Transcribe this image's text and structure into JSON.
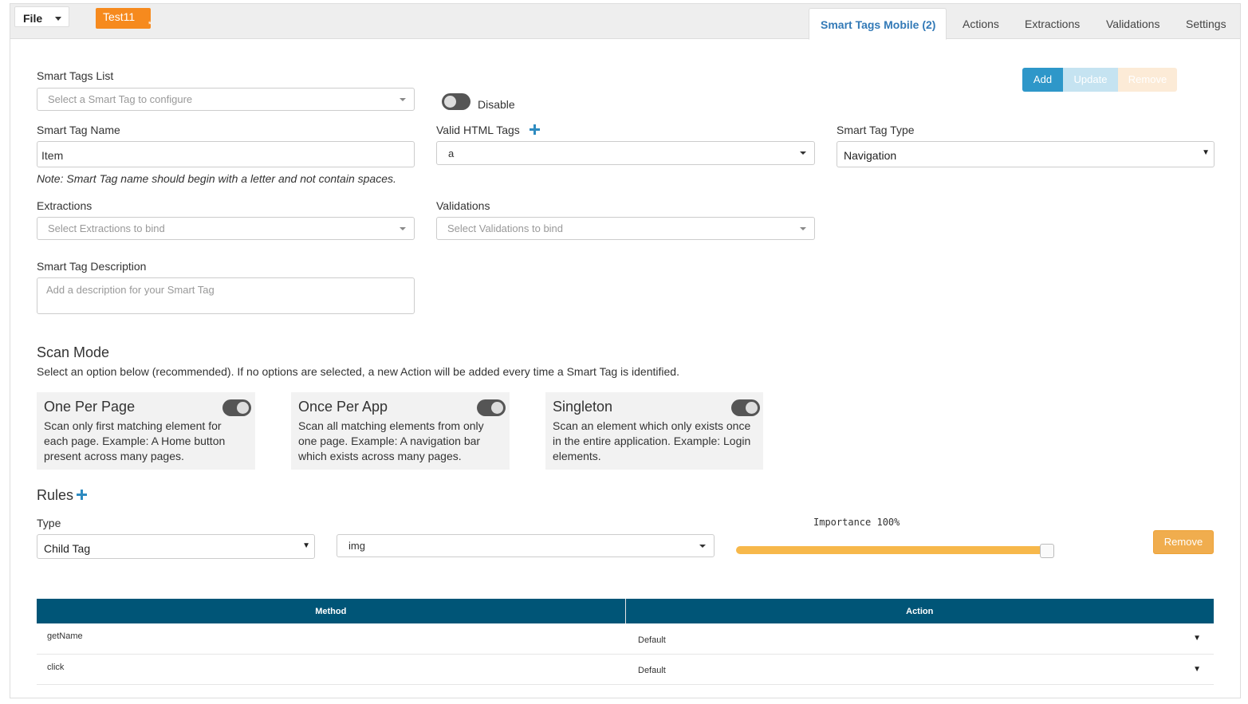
{
  "header": {
    "file_label": "File",
    "project_name": "Test11",
    "unsaved_marker": "*",
    "tabs": [
      "Smart Tags Mobile (2)",
      "Actions",
      "Extractions",
      "Validations",
      "Settings"
    ]
  },
  "form": {
    "smart_tags_list_label": "Smart Tags List",
    "smart_tags_list_placeholder": "Select a Smart Tag to configure",
    "disable_label": "Disable",
    "buttons": {
      "add": "Add",
      "update": "Update",
      "remove": "Remove"
    },
    "smart_tag_name_label": "Smart Tag Name",
    "smart_tag_name_value": "Item",
    "name_note": "Note: Smart Tag name should begin with a letter and not contain spaces.",
    "valid_html_tags_label": "Valid HTML Tags",
    "valid_html_tags_value": "a",
    "smart_tag_type_label": "Smart Tag Type",
    "smart_tag_type_value": "Navigation",
    "extractions_label": "Extractions",
    "extractions_placeholder": "Select Extractions to bind",
    "validations_label": "Validations",
    "validations_placeholder": "Select Validations to bind",
    "description_label": "Smart Tag Description",
    "description_placeholder": "Add a description for your Smart Tag"
  },
  "scan_mode": {
    "title": "Scan Mode",
    "subtitle": "Select an option below (recommended). If no options are selected, a new Action will be added every time a Smart Tag is identified.",
    "options": [
      {
        "title": "One Per Page",
        "description": "Scan only first matching element for each page. Example: A Home button present across many pages."
      },
      {
        "title": "Once Per App",
        "description": "Scan all matching elements from only one page. Example: A navigation bar which exists across many pages."
      },
      {
        "title": "Singleton",
        "description": "Scan an element which only exists once in the entire application. Example: Login elements."
      }
    ]
  },
  "rules": {
    "title": "Rules",
    "type_label": "Type",
    "type_value": "Child Tag",
    "tag_value": "img",
    "importance_label": "Importance 100%",
    "importance_percent": 100,
    "remove_label": "Remove"
  },
  "methods_table": {
    "headers": [
      "Method",
      "Action"
    ],
    "rows": [
      {
        "method": "getName",
        "action": "Default"
      },
      {
        "method": "click",
        "action": "Default"
      }
    ]
  },
  "colors": {
    "accent_blue": "#337ab7",
    "add_button": "#2e97c9",
    "remove_button": "#f0ad4e",
    "project_badge": "#f68a1e",
    "table_header": "#005577",
    "slider_fill": "#f7b84b"
  }
}
